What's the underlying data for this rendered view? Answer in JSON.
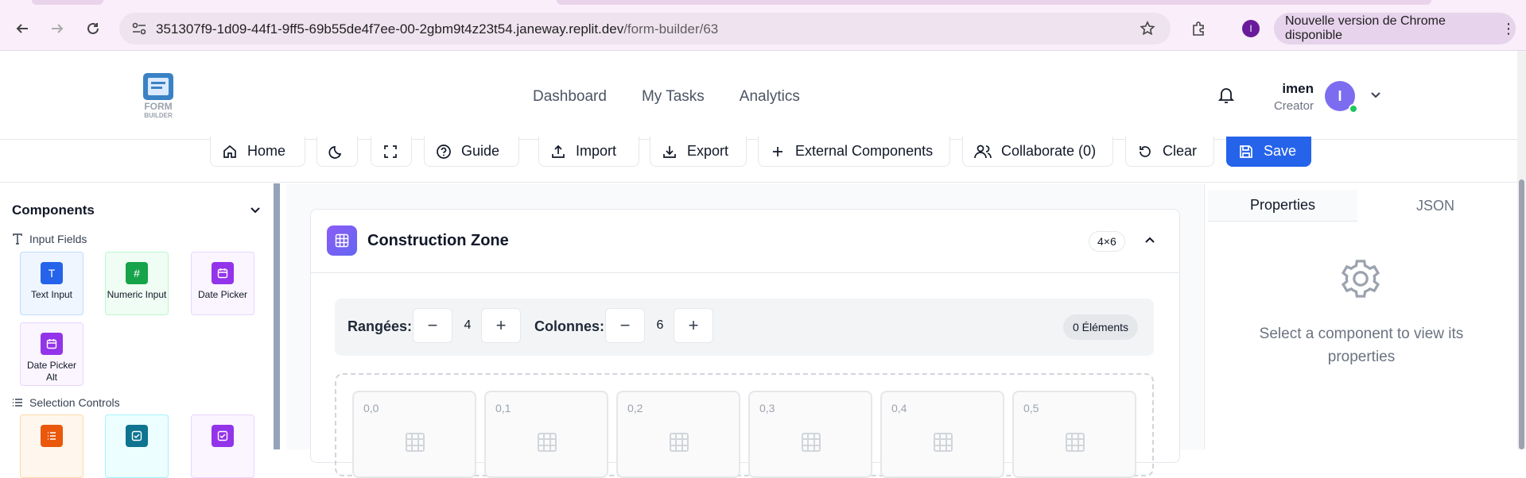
{
  "browser": {
    "url_host": "351307f9-1d09-44f1-9ff5-69b55de4f7ee-00-2gbm9t4z23t54.janeway.replit.dev",
    "url_path": "/form-builder/63",
    "profile_initial": "I",
    "update_label": "Nouvelle version de Chrome disponible"
  },
  "header": {
    "logo_text_1": "FORM",
    "logo_text_2": "BUILDER",
    "nav": [
      "Dashboard",
      "My Tasks",
      "Analytics"
    ],
    "user_name": "imen",
    "user_role": "Creator",
    "user_initial": "I"
  },
  "toolbar": {
    "home": "Home",
    "guide": "Guide",
    "import": "Import",
    "export": "Export",
    "external": "External Components",
    "collaborate": "Collaborate (0)",
    "clear": "Clear",
    "save": "Save"
  },
  "sidebar": {
    "title": "Components",
    "categories": [
      {
        "label": "Input Fields",
        "items": [
          "Text Input",
          "Numeric Input",
          "Date Picker",
          "Date Picker Alt"
        ]
      },
      {
        "label": "Selection Controls",
        "items": [
          "",
          "",
          ""
        ]
      }
    ],
    "icon_glyphs": {
      "text": "T",
      "numeric": "#"
    }
  },
  "construction": {
    "title": "Construction Zone",
    "grid_badge": "4×6",
    "rows_label": "Rangées:",
    "rows_value": "4",
    "cols_label": "Colonnes:",
    "cols_value": "6",
    "minus": "−",
    "plus": "+",
    "elements_badge": "0 Éléments",
    "cells": [
      "0,0",
      "0,1",
      "0,2",
      "0,3",
      "0,4",
      "0,5"
    ]
  },
  "properties": {
    "tab_properties": "Properties",
    "tab_json": "JSON",
    "empty_message": "Select a component to view its properties"
  },
  "colors": {
    "primary": "#2563eb",
    "text_input": "#2563eb",
    "numeric": "#16a34a",
    "date": "#9333ea",
    "select_orange": "#ea580c",
    "select_teal": "#0e7490"
  }
}
